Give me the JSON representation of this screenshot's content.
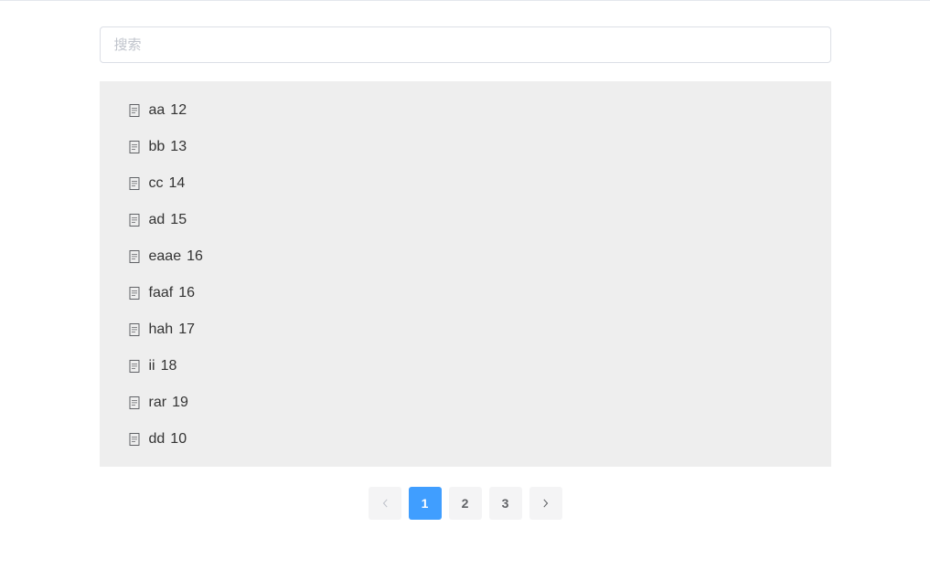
{
  "search": {
    "placeholder": "搜索",
    "value": ""
  },
  "list": {
    "items": [
      {
        "name": "aa",
        "age": "12"
      },
      {
        "name": "bb",
        "age": "13"
      },
      {
        "name": "cc",
        "age": "14"
      },
      {
        "name": "ad",
        "age": "15"
      },
      {
        "name": "eaae",
        "age": "16"
      },
      {
        "name": "faaf",
        "age": "16"
      },
      {
        "name": "hah",
        "age": "17"
      },
      {
        "name": "ii",
        "age": "18"
      },
      {
        "name": "rar",
        "age": "19"
      },
      {
        "name": "dd",
        "age": "10"
      }
    ]
  },
  "pagination": {
    "pages": [
      "1",
      "2",
      "3"
    ],
    "current": 1,
    "prev_disabled": true,
    "next_disabled": false
  }
}
